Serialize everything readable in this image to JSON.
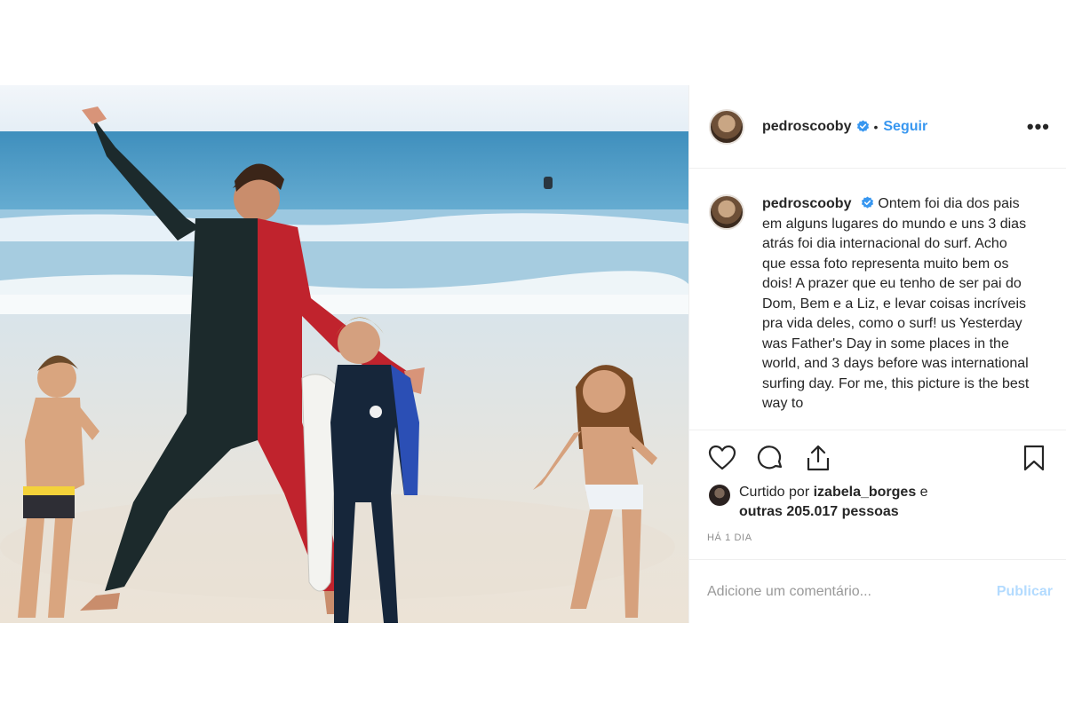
{
  "post": {
    "username": "pedroscooby",
    "follow_label": "Seguir",
    "separator": "•",
    "more_label": "•••",
    "caption": {
      "username": "pedroscooby",
      "text": "Ontem foi dia dos pais em alguns lugares do mundo e uns 3 dias atrás foi dia internacional do surf. Acho que essa foto representa muito bem os dois! A prazer que eu tenho de ser pai do Dom, Bem e a Liz, e levar coisas incríveis pra vida deles, como o surf! us Yesterday was Father's Day in some places in the world, and 3 days before was international surfing day. For me, this picture is the best way to"
    },
    "likes": {
      "prefix": "Curtido por",
      "user": "izabela_borges",
      "connector": "e",
      "others": "outras 205.017 pessoas"
    },
    "timestamp": "HÁ 1 DIA",
    "comment": {
      "placeholder": "Adicione um comentário...",
      "publish_label": "Publicar"
    }
  },
  "colors": {
    "link": "#3897f0",
    "publish_disabled": "#b3dbff",
    "verified": "#3897f0",
    "muted": "#8e8e8e"
  },
  "icons": [
    "heart-icon",
    "comment-icon",
    "share-icon",
    "bookmark-icon",
    "verified-badge-icon"
  ]
}
